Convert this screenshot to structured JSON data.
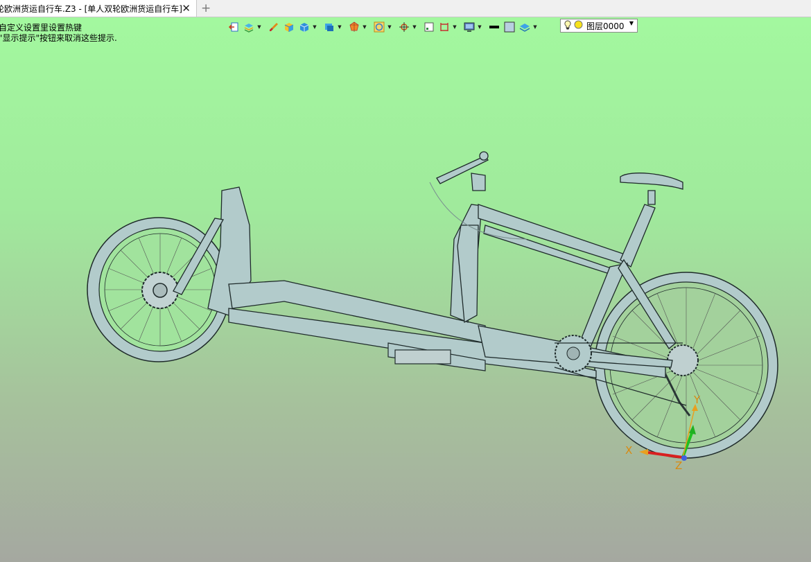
{
  "tab": {
    "title": "轮欧洲货运自行车.Z3 - [单人双轮欧洲货运自行车]",
    "close_glyph": "✕",
    "add_glyph": "+"
  },
  "hints": {
    "line1": "自定义设置里设置热键",
    "line2": "\"显示提示\"按钮来取消这些提示."
  },
  "toolbar": {
    "icons": [
      "exit-view-icon",
      "layer-stack-icon",
      "brush-icon",
      "box-shaded-icon",
      "cube-icon",
      "view-cube-icon",
      "render-sphere-icon",
      "circle-select-icon",
      "pivot-icon",
      "frame-icon",
      "dimension-icon",
      "display-icon",
      "line-black-icon",
      "fill-color-icon",
      "material-icon"
    ],
    "layer_label": "图层0000",
    "layer_dropdown_glyph": "▼"
  },
  "axes": {
    "x_label": "X",
    "y_label": "Y",
    "z_label": "Z"
  },
  "colors": {
    "viewport_top": "#a3f89f",
    "viewport_bottom": "#a5a8a0",
    "model_fill": "#b2cbcb",
    "model_edge": "#1e2a2a"
  }
}
